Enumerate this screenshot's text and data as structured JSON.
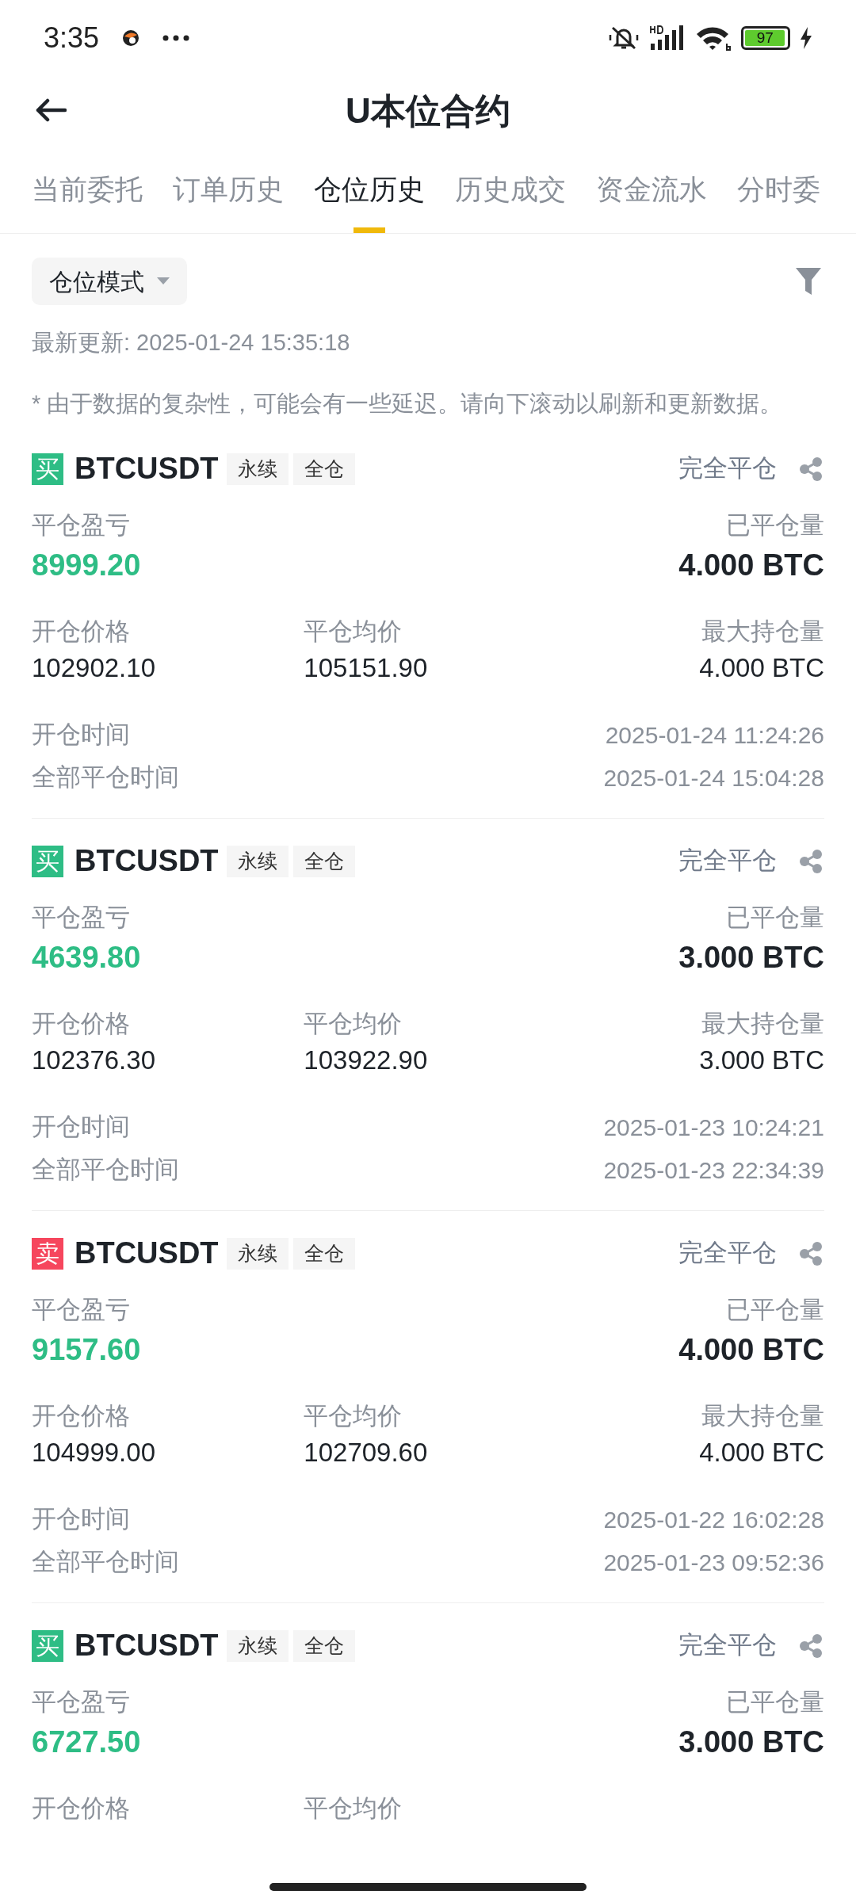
{
  "status_bar": {
    "time": "3:35",
    "battery": "97"
  },
  "header": {
    "title": "U本位合约"
  },
  "tabs": [
    {
      "label": "当前委托",
      "selected": false
    },
    {
      "label": "订单历史",
      "selected": false
    },
    {
      "label": "仓位历史",
      "selected": true
    },
    {
      "label": "历史成交",
      "selected": false
    },
    {
      "label": "资金流水",
      "selected": false
    },
    {
      "label": "分时委",
      "selected": false
    }
  ],
  "mode_dropdown": {
    "label": "仓位模式"
  },
  "last_update": "最新更新: 2025-01-24 15:35:18",
  "notice": "* 由于数据的复杂性，可能会有一些延迟。请向下滚动以刷新和更新数据。",
  "positions": [
    {
      "side": "买",
      "color": "#2ebd85",
      "symbol": "BTCUSDT",
      "tags": [
        "永续",
        "全仓"
      ],
      "status": "完全平仓",
      "pnl_label": "平仓盈亏",
      "pnl": "8999.20",
      "qty_label": "已平仓量",
      "qty": "4.000 BTC",
      "open_price_label": "开仓价格",
      "open_price": "102902.10",
      "avg_close_label": "平仓均价",
      "avg_close": "105151.90",
      "max_qty_label": "最大持仓量",
      "max_qty": "4.000 BTC",
      "open_time_label": "开仓时间",
      "open_time": "2025-01-24 11:24:26",
      "close_time_label": "全部平仓时间",
      "close_time": "2025-01-24 15:04:28"
    },
    {
      "side": "买",
      "color": "#2ebd85",
      "symbol": "BTCUSDT",
      "tags": [
        "永续",
        "全仓"
      ],
      "status": "完全平仓",
      "pnl_label": "平仓盈亏",
      "pnl": "4639.80",
      "qty_label": "已平仓量",
      "qty": "3.000 BTC",
      "open_price_label": "开仓价格",
      "open_price": "102376.30",
      "avg_close_label": "平仓均价",
      "avg_close": "103922.90",
      "max_qty_label": "最大持仓量",
      "max_qty": "3.000 BTC",
      "open_time_label": "开仓时间",
      "open_time": "2025-01-23 10:24:21",
      "close_time_label": "全部平仓时间",
      "close_time": "2025-01-23 22:34:39"
    },
    {
      "side": "卖",
      "color": "#f6465d",
      "symbol": "BTCUSDT",
      "tags": [
        "永续",
        "全仓"
      ],
      "status": "完全平仓",
      "pnl_label": "平仓盈亏",
      "pnl": "9157.60",
      "qty_label": "已平仓量",
      "qty": "4.000 BTC",
      "open_price_label": "开仓价格",
      "open_price": "104999.00",
      "avg_close_label": "平仓均价",
      "avg_close": "102709.60",
      "max_qty_label": "最大持仓量",
      "max_qty": "4.000 BTC",
      "open_time_label": "开仓时间",
      "open_time": "2025-01-22 16:02:28",
      "close_time_label": "全部平仓时间",
      "close_time": "2025-01-23 09:52:36"
    },
    {
      "side": "买",
      "color": "#2ebd85",
      "symbol": "BTCUSDT",
      "tags": [
        "永续",
        "全仓"
      ],
      "status": "完全平仓",
      "pnl_label": "平仓盈亏",
      "pnl": "6727.50",
      "qty_label": "已平仓量",
      "qty": "3.000 BTC",
      "open_price_label": "开仓价格",
      "avg_close_label": "平仓均价"
    }
  ]
}
